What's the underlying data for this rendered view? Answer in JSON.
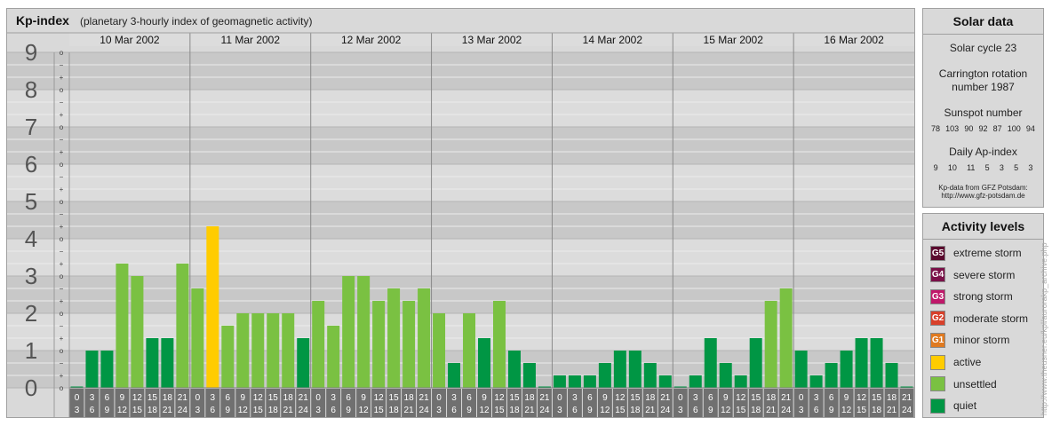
{
  "main": {
    "title": "Kp-index",
    "subtitle": "(planetary 3-hourly index of geomagnetic activity)"
  },
  "chart_data": {
    "type": "bar",
    "ylim": [
      0,
      9
    ],
    "y_ticks": [
      "0",
      "1",
      "2",
      "3",
      "4",
      "5",
      "6",
      "7",
      "8",
      "9"
    ],
    "minor_ticks": [
      "o",
      "+",
      "−"
    ],
    "grid": true,
    "legend_position": "right",
    "days": [
      "10 Mar 2002",
      "11 Mar 2002",
      "12 Mar 2002",
      "13 Mar 2002",
      "14 Mar 2002",
      "15 Mar 2002",
      "16 Mar 2002"
    ],
    "interval_top": [
      "0",
      "3",
      "6",
      "9",
      "12",
      "15",
      "18",
      "21"
    ],
    "interval_bottom": [
      "3",
      "6",
      "9",
      "12",
      "15",
      "18",
      "21",
      "24"
    ],
    "values": [
      0,
      1,
      1,
      3.333,
      3,
      1.333,
      1.333,
      3.333,
      2.667,
      4.333,
      1.667,
      2,
      2,
      2,
      2,
      1.333,
      2.333,
      1.667,
      3,
      3,
      2.333,
      2.667,
      2.333,
      2.667,
      2,
      0.667,
      2,
      1.333,
      2.333,
      1,
      0.667,
      0,
      0.333,
      0.333,
      0.333,
      0.667,
      1,
      1,
      0.667,
      0.333,
      0,
      0.333,
      1.333,
      0.667,
      0.333,
      1.333,
      2.333,
      2.667,
      1,
      0.333,
      0.667,
      1,
      1.333,
      1.333,
      0.667,
      0
    ],
    "level_colors": {
      "quiet": "#009644",
      "unsettled": "#7ac142",
      "active": "#ffcc00"
    }
  },
  "solar": {
    "title": "Solar data",
    "cycle": "Solar cycle 23",
    "carrington_line1": "Carrington rotation",
    "carrington_line2": "number 1987",
    "sunspot_label": "Sunspot number",
    "sunspot_values": [
      "78",
      "103",
      "90",
      "92",
      "87",
      "100",
      "94"
    ],
    "ap_label": "Daily Ap-index",
    "ap_values": [
      "9",
      "10",
      "11",
      "5",
      "3",
      "5",
      "3"
    ],
    "source_line1": "Kp-data from GFZ Potsdam:",
    "source_line2": "http://www.gfz-potsdam.de"
  },
  "activity": {
    "title": "Activity levels",
    "levels": [
      {
        "code": "G5",
        "label": "extreme storm",
        "color": "#5a0a2e"
      },
      {
        "code": "G4",
        "label": "severe storm",
        "color": "#7a1048"
      },
      {
        "code": "G3",
        "label": "strong storm",
        "color": "#c0186a"
      },
      {
        "code": "G2",
        "label": "moderate storm",
        "color": "#d8402a"
      },
      {
        "code": "G1",
        "label": "minor storm",
        "color": "#e07a20"
      },
      {
        "code": "",
        "label": "active",
        "color": "#ffcc00"
      },
      {
        "code": "",
        "label": "unsettled",
        "color": "#7ac142"
      },
      {
        "code": "",
        "label": "quiet",
        "color": "#009644"
      }
    ]
  },
  "watermark": "http://www.theusner.eu/kpl/aurorakp_archive.php"
}
